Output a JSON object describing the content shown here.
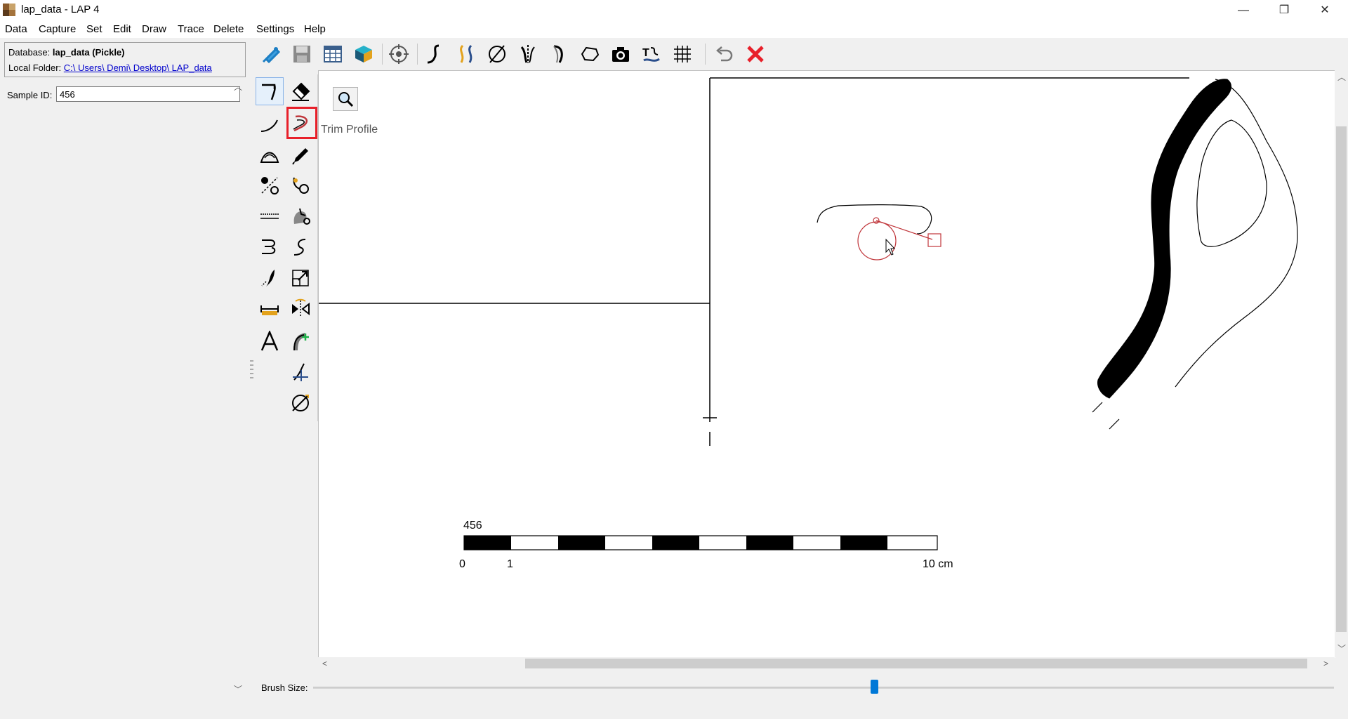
{
  "window": {
    "title": "lap_data - LAP 4",
    "minimize_glyph": "—",
    "maximize_glyph": "❐",
    "close_glyph": "✕"
  },
  "menu": [
    "Data",
    "Capture",
    "Set",
    "Edit",
    "Draw",
    "Trace",
    "Delete",
    "Settings",
    "Help"
  ],
  "database": {
    "label": "Database:",
    "name": "lap_data (Pickle)",
    "folder_label": "Local Folder:",
    "folder_path": "C:\\ Users\\ Demi\\ Desktop\\ LAP_data"
  },
  "sample": {
    "label": "Sample ID:",
    "value": "456"
  },
  "toolbar_icons": [
    "capture-pen-icon",
    "save-icon",
    "table-icon",
    "3d-box-icon",
    "target-icon",
    "profile-curve-icon",
    "double-curve-icon",
    "diameter-icon",
    "centerline-icon",
    "handle-icon",
    "polygon-icon",
    "camera-icon",
    "text-trace-icon",
    "grid-icon",
    "undo-icon",
    "cancel-icon"
  ],
  "palette_icons": [
    "select-profile-icon",
    "eraser-icon",
    "line-curve-icon",
    "trim-profile-icon",
    "arc-tool-icon",
    "pencil-icon",
    "split-points-icon",
    "join-points-icon",
    "dashed-line-icon",
    "fill-shape-icon",
    "offset-curve-icon",
    "s-curve-icon",
    "thickness-icon",
    "resize-icon",
    "measure-icon",
    "mirror-icon",
    "text-tool-icon",
    "add-handle-icon",
    "add-line-icon",
    "diameter-tool-icon"
  ],
  "tooltip": "Trim Profile",
  "scale_bar": {
    "sample_id": "456",
    "label_start": "0",
    "label_one": "1",
    "label_end": "10 cm"
  },
  "brush": {
    "label": "Brush Size:",
    "level_percent": 55
  },
  "colors": {
    "highlight": "#e8202a",
    "annotation": "#c0363b",
    "link": "#0000cc",
    "slider": "#0078d7"
  }
}
